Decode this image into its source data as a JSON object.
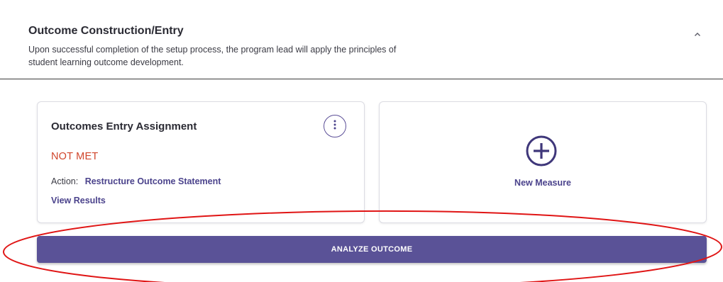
{
  "section": {
    "title": "Outcome Construction/Entry",
    "description": "Upon successful completion of the setup process, the program lead will apply the principles of student learning outcome development.",
    "collapse_icon": "chevron-up-icon"
  },
  "assignment_card": {
    "title": "Outcomes Entry Assignment",
    "menu_icon": "more-vertical-icon",
    "status": "NOT MET",
    "action_label": "Action:",
    "action_value": "Restructure Outcome Statement",
    "view_results_label": "View Results"
  },
  "new_measure_card": {
    "icon": "plus-circle-icon",
    "label": "New Measure"
  },
  "analyze_button": {
    "label": "ANALYZE OUTCOME"
  },
  "colors": {
    "accent": "#5a5297",
    "link": "#4b438c",
    "status_not_met": "#d0452b",
    "annotation": "#e01515"
  }
}
